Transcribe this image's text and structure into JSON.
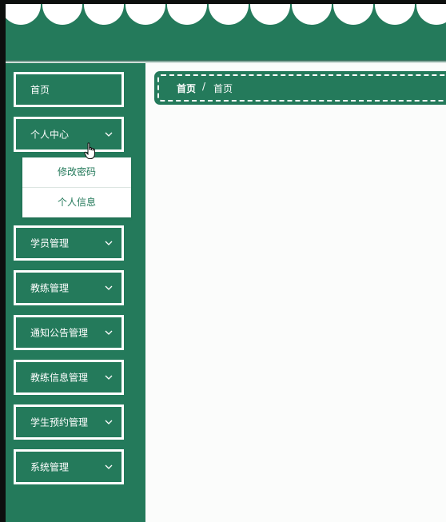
{
  "colors": {
    "primary": "#247a5b",
    "background": "#fbfcfb",
    "white": "#ffffff"
  },
  "header": {
    "decoration": "scalloped-edge"
  },
  "sidebar": {
    "items": [
      {
        "label": "首页"
      },
      {
        "label": "个人中心",
        "expanded": true,
        "chevron": "chevron-down-icon"
      },
      {
        "label": "学员管理",
        "chevron": "chevron-down-icon"
      },
      {
        "label": "教练管理",
        "chevron": "chevron-down-icon"
      },
      {
        "label": "通知公告管理",
        "chevron": "chevron-down-icon"
      },
      {
        "label": "教练信息管理",
        "chevron": "chevron-down-icon"
      },
      {
        "label": "学生预约管理",
        "chevron": "chevron-down-icon"
      },
      {
        "label": "系统管理",
        "chevron": "chevron-down-icon"
      }
    ],
    "submenu": [
      {
        "label": "修改密码"
      },
      {
        "label": "个人信息"
      }
    ]
  },
  "breadcrumb": {
    "home": "首页",
    "separator": "/",
    "current": "首页"
  },
  "cursor": {
    "icon": "hand-pointer-icon"
  }
}
